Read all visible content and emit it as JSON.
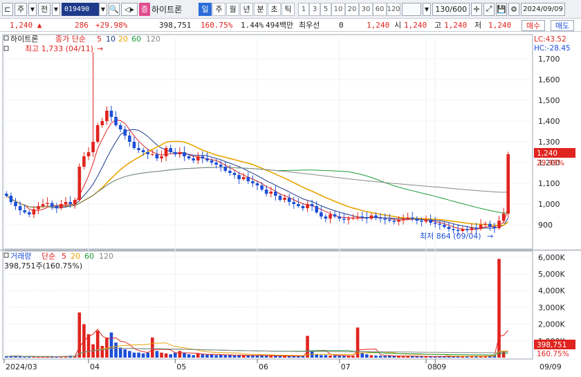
{
  "toolbar": {
    "market_type": "주",
    "view_label": "전",
    "stock_code": "019490",
    "stock_name": "하이트론",
    "stock_badge": "증",
    "timeframes": [
      "일",
      "주",
      "월",
      "년",
      "분",
      "초",
      "틱"
    ],
    "active_timeframe": "일",
    "periods": [
      "1",
      "3",
      "5",
      "10",
      "20",
      "30",
      "60",
      "120"
    ],
    "count_display": "130/600",
    "date": "2024/09/09"
  },
  "quote": {
    "price": "1,240",
    "change": "286",
    "change_pct": "+29.98%",
    "volume": "398,751",
    "volume_ratio": "160.75%",
    "turnover": "1.44%",
    "amount": "494백만",
    "best_bid_label": "최우선",
    "best_bid": "0",
    "best_bid_price": "1,240",
    "open_label": "시",
    "open": "1,240",
    "high_label": "고",
    "high": "1,240",
    "low_label": "저",
    "low": "1,240",
    "buy_label": "매수",
    "sell_label": "매도"
  },
  "legend": {
    "stock_name": "하이트론",
    "ma_label": "종가 단순",
    "ma_periods": [
      "5",
      "10",
      "20",
      "60",
      "120"
    ],
    "ma_colors": [
      "#e0241f",
      "#1e3a8a",
      "#e8a400",
      "#1a9c3a",
      "#888888"
    ],
    "lc": "LC:43.52",
    "hc": "HC:-28.45",
    "max_annotation": "최고 1,733 (04/11)",
    "min_annotation": "최저 864 (09/04)",
    "current_price_tag": "1,240",
    "current_pct_tag": "29.98%"
  },
  "volume_legend": {
    "title": "거래량",
    "ma_label": "단순",
    "ma_periods": [
      "5",
      "20",
      "60",
      "120"
    ],
    "current": "398,751주(160.75%)",
    "current_tag": "398,751",
    "current_pct_tag": "160.75%"
  },
  "x_axis": {
    "labels": [
      "2024/03",
      "04",
      "05",
      "06",
      "07",
      "08",
      "09"
    ],
    "end_label": "09/09"
  },
  "colors": {
    "up": "#e0241f",
    "down": "#1d4fd8",
    "accent": "#2b6cd8"
  },
  "chart_data": {
    "type": "candlestick",
    "price_axis": {
      "ticks": [
        900,
        1000,
        1100,
        1200,
        1300,
        1400,
        1500,
        1600,
        1700
      ],
      "range": [
        800,
        1800
      ]
    },
    "volume_axis": {
      "ticks": [
        "1,000K",
        "2,000K",
        "3,000K",
        "4,000K",
        "5,000K",
        "6,000K"
      ],
      "range": [
        0,
        6200000
      ]
    },
    "max_price": 1733,
    "min_price": 864,
    "last_close": 1240,
    "closes": [
      1040,
      1010,
      990,
      970,
      960,
      950,
      975,
      990,
      1000,
      1005,
      990,
      980,
      1000,
      1010,
      1000,
      1020,
      1180,
      1230,
      1250,
      1300,
      1380,
      1400,
      1450,
      1420,
      1380,
      1360,
      1330,
      1300,
      1270,
      1260,
      1250,
      1240,
      1240,
      1220,
      1230,
      1270,
      1250,
      1240,
      1250,
      1230,
      1220,
      1210,
      1230,
      1220,
      1210,
      1200,
      1190,
      1180,
      1160,
      1150,
      1140,
      1120,
      1130,
      1110,
      1100,
      1090,
      1070,
      1050,
      1060,
      1040,
      1020,
      1030,
      1010,
      1000,
      990,
      980,
      1000,
      990,
      960,
      940,
      930,
      950,
      940,
      930,
      925,
      930,
      935,
      940,
      935,
      930,
      945,
      935,
      930,
      925,
      920,
      915,
      925,
      930,
      935,
      930,
      920,
      915,
      925,
      910,
      905,
      900,
      890,
      880,
      875,
      870,
      880,
      875,
      885,
      880,
      900,
      905,
      890,
      884,
      920,
      954,
      1240
    ],
    "volumes": [
      80,
      90,
      120,
      60,
      40,
      60,
      50,
      45,
      40,
      70,
      60,
      50,
      80,
      90,
      120,
      100,
      2700,
      2000,
      1400,
      800,
      1600,
      700,
      1200,
      1500,
      900,
      600,
      500,
      400,
      300,
      300,
      250,
      300,
      1200,
      400,
      300,
      250,
      200,
      300,
      400,
      300,
      200,
      150,
      250,
      200,
      180,
      200,
      150,
      170,
      150,
      160,
      130,
      140,
      150,
      130,
      120,
      140,
      130,
      120,
      100,
      110,
      100,
      90,
      100,
      90,
      95,
      100,
      1300,
      400,
      200,
      150,
      150,
      130,
      120,
      110,
      100,
      100,
      90,
      1800,
      300,
      200,
      150,
      120,
      110,
      100,
      110,
      100,
      90,
      80,
      90,
      85,
      80,
      70,
      75,
      70,
      80,
      70,
      60,
      70,
      80,
      90,
      100,
      85,
      95,
      90,
      100,
      110,
      120,
      130,
      5900,
      399
    ]
  }
}
